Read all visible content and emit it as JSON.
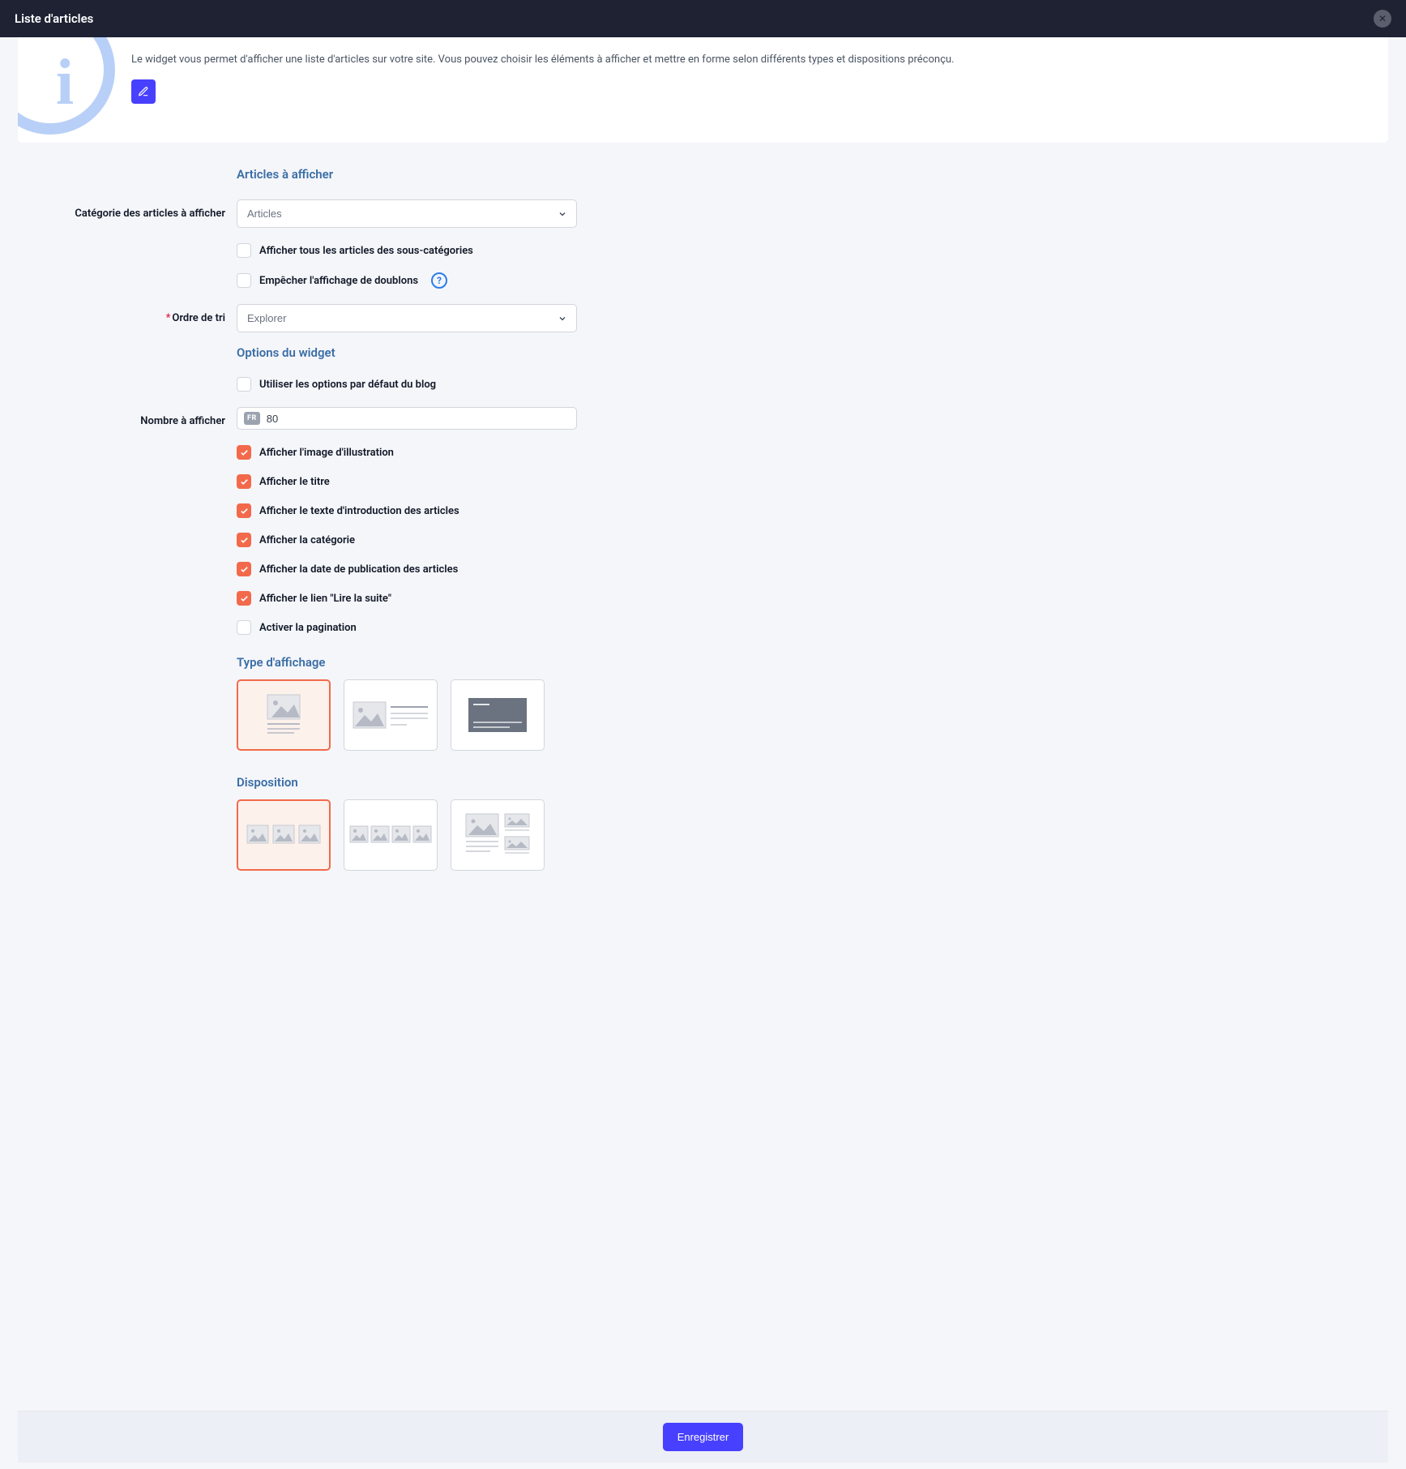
{
  "header": {
    "title": "Liste d'articles"
  },
  "info": {
    "text": "Le widget vous permet d'afficher une liste d'articles sur votre site. Vous pouvez choisir les éléments à afficher et mettre en forme selon différents types et dispositions préconçu."
  },
  "sections": {
    "articles": "Articles à afficher",
    "options": "Options du widget",
    "display_type": "Type d'affichage",
    "disposition": "Disposition"
  },
  "labels": {
    "category": "Catégorie des articles à afficher",
    "sort_order": "Ordre de tri",
    "count": "Nombre à afficher"
  },
  "fields": {
    "category_value": "Articles",
    "sort_value": "Explorer",
    "lang_badge": "FR",
    "count_value": "80"
  },
  "checks": {
    "sub_categories": "Afficher tous les articles des sous-catégories",
    "no_duplicates": "Empêcher l'affichage de doublons",
    "default_options": "Utiliser les options par défaut du blog",
    "show_image": "Afficher l'image d'illustration",
    "show_title": "Afficher le titre",
    "show_intro": "Afficher le texte d'introduction des articles",
    "show_category": "Afficher la catégorie",
    "show_date": "Afficher la date de publication des articles",
    "show_readmore": "Afficher le lien \"Lire la suite\"",
    "enable_pagination": "Activer la pagination"
  },
  "footer": {
    "save": "Enregistrer"
  }
}
